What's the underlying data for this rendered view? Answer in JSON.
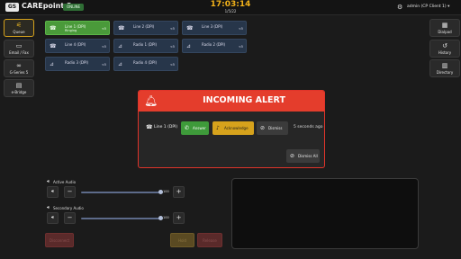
{
  "header": {
    "logo": "GS",
    "title": "CAREpoint 3",
    "status": "ONLINE",
    "time": "17:03:14",
    "date": "1/5/22",
    "user": "admin (CP Client 1)",
    "user_chevron": "▾"
  },
  "sidebar": {
    "items": [
      {
        "label": "Queue",
        "icon": "list-icon",
        "glyph": "⚟",
        "active": true
      },
      {
        "label": "Email / Fax",
        "icon": "mail-icon",
        "glyph": "▭",
        "active": false
      },
      {
        "label": "G-Series 5",
        "icon": "link-icon",
        "glyph": "∞",
        "active": false
      },
      {
        "label": "e-Bridge",
        "icon": "card-icon",
        "glyph": "▤",
        "active": false
      }
    ]
  },
  "lines": [
    {
      "label": "Line 1 (DPI)",
      "sub": "Ringing",
      "right": "<5",
      "style": "green"
    },
    {
      "label": "Line 2 (DPI)",
      "sub": "",
      "right": "<5",
      "style": "blue"
    },
    {
      "label": "Line 3 (DPI)",
      "sub": "",
      "right": "<5",
      "style": "blue"
    },
    {
      "label": "Line 4 (DPI)",
      "sub": "",
      "right": "<5",
      "style": "blue"
    },
    {
      "label": "Radio 1 (DPI)",
      "sub": "",
      "right": "<5",
      "style": "blue"
    },
    {
      "label": "Radio 2 (DPI)",
      "sub": "",
      "right": "<5",
      "style": "blue"
    },
    {
      "label": "Radio 3 (DPI)",
      "sub": "",
      "right": "<5",
      "style": "blue"
    },
    {
      "label": "Radio 4 (DPI)",
      "sub": "",
      "right": "<5",
      "style": "blue"
    }
  ],
  "alert": {
    "title": "INCOMING ALERT",
    "line": "Line 1 (DPI)",
    "answer": "Answer",
    "acknowledge": "Acknowledge",
    "dismiss": "Dismiss",
    "elapsed": "5 seconds ago",
    "dismiss_all": "Dismiss All"
  },
  "right_panel": {
    "items": [
      {
        "label": "Dialpad",
        "icon": "dialpad-icon",
        "glyph": "▦"
      },
      {
        "label": "History",
        "icon": "history-icon",
        "glyph": "↺"
      },
      {
        "label": "Directory",
        "icon": "directory-icon",
        "glyph": "▥"
      }
    ]
  },
  "audio": {
    "active_label": "Active Audio",
    "active_level": 0.98,
    "active_pct": "100",
    "secondary_label": "Secondary Audio",
    "secondary_level": 0.98,
    "secondary_pct": "100"
  },
  "bottom_buttons": {
    "left": "Disconnect",
    "mid": "Hold",
    "right": "Release"
  },
  "colors": {
    "accent": "#d6a21c",
    "alert_red": "#e43d2c",
    "answer_green": "#3e9a3a",
    "line_blue": "#27364a"
  }
}
